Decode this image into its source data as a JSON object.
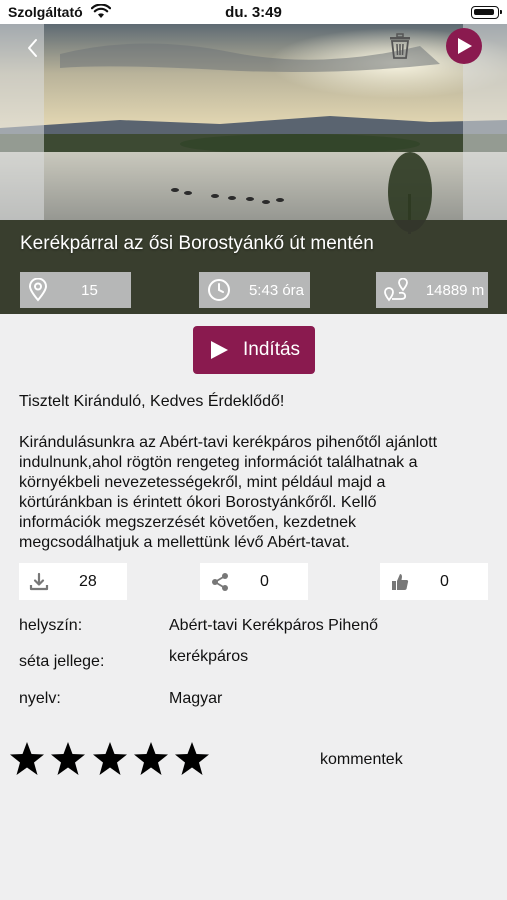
{
  "status_bar": {
    "carrier": "Szolgáltató",
    "time": "du. 3:49"
  },
  "hero": {
    "title": "Kerékpárral az ősi Borostyánkő út mentén",
    "stats": {
      "points": "15",
      "duration": "5:43 óra",
      "distance": "14889 m"
    }
  },
  "actions": {
    "start_label": "Indítás"
  },
  "description": {
    "greeting": "Tisztelt Kiránduló, Kedves Érdeklődő!",
    "lines": [
      "Kirándulásunkra az Abért-tavi kerékpáros pihenőtől ajánlott",
      "indulnunk,ahol rögtön rengeteg információt találhatnak a",
      "környékbeli nevezetességekről, mint például majd a",
      "körtúránkban is érintett ókori Borostyánkőről. Kellő",
      "információk megszerzését követően, kezdetnek",
      "megcsodálhatjuk a mellettünk lévő Abért-tavat."
    ]
  },
  "counters": {
    "downloads": "28",
    "shares": "0",
    "likes": "0"
  },
  "info": {
    "location_label": "helyszín:",
    "location_value": "Abért-tavi Kerékpáros Pihenő",
    "type_label": "séta jellege:",
    "type_value": "kerékpáros",
    "language_label": "nyelv:",
    "language_value": "Magyar"
  },
  "rating": {
    "stars_total": 5,
    "stars_filled": 5,
    "comments_label": "kommentek"
  },
  "colors": {
    "accent": "#8a1a4f",
    "background": "#efeff0"
  }
}
